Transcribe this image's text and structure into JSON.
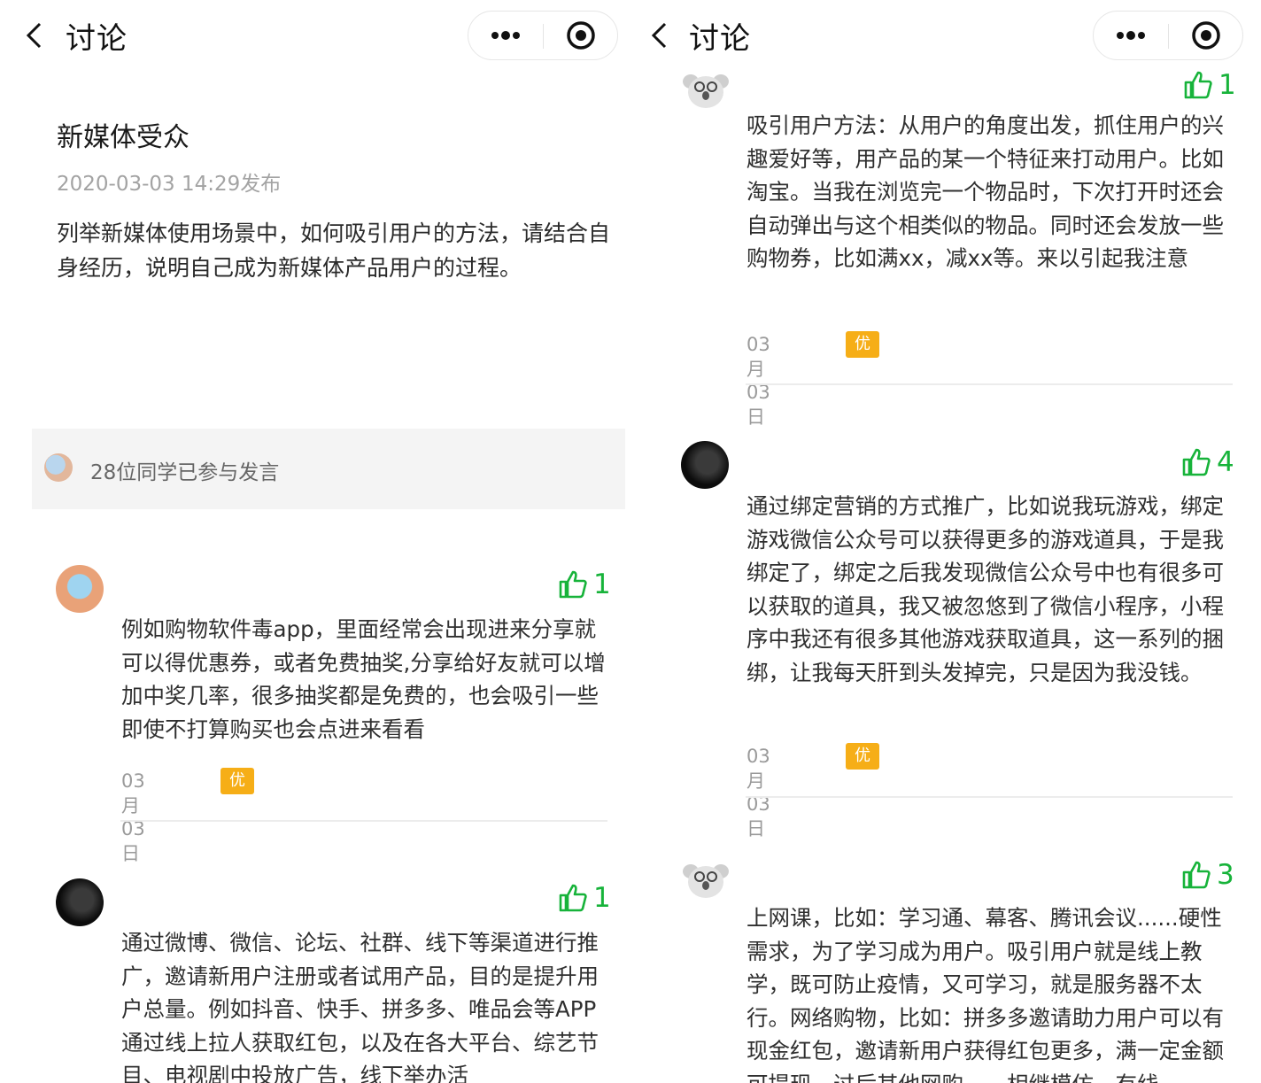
{
  "header": {
    "title": "讨论"
  },
  "topic": {
    "title": "新媒体受众",
    "date": "2020-03-03 14:29发布",
    "body": "列举新媒体使用场景中，如何吸引用户的方法，请结合自身经历，说明自己成为新媒体产品用户的过程。",
    "participants": "28位同学已参与发言"
  },
  "left_comments": [
    {
      "likes": "1",
      "text": "例如购物软件毒app，里面经常会出现进来分享就可以得优惠券，或者免费抽奖,分享给好友就可以增加中奖几率，很多抽奖都是免费的，也会吸引一些即使不打算购买也会点进来看看",
      "date": "03月03日",
      "badge": "优秀发言"
    },
    {
      "likes": "1",
      "text": "通过微博、微信、论坛、社群、线下等渠道进行推广，邀请新用户注册或者试用产品，目的是提升用户总量。例如抖音、快手、拼多多、唯品会等APP通过线上拉人获取红包，以及在各大平台、综艺节目、电视剧中投放广告，线下举办活"
    }
  ],
  "right_comments": [
    {
      "likes": "1",
      "text": "吸引用户方法：从用户的角度出发，抓住用户的兴趣爱好等，用产品的某一个特征来打动用户。比如淘宝。当我在浏览完一个物品时，下次打开时还会自动弹出与这个相类似的物品。同时还会发放一些购物券，比如满xx，减xx等。来以引起我注意",
      "date": "03月03日",
      "badge": "优秀发言"
    },
    {
      "likes": "4",
      "text": "通过绑定营销的方式推广，比如说我玩游戏，绑定游戏微信公众号可以获得更多的游戏道具，于是我绑定了，绑定之后我发现微信公众号中也有很多可以获取的道具，我又被忽悠到了微信小程序，小程序中我还有很多其他游戏获取道具，这一系列的捆绑，让我每天肝到头发掉完，只是因为我没钱。",
      "date": "03月03日",
      "badge": "优秀发言"
    },
    {
      "likes": "3",
      "text": "上网课，比如：学习通、幕客、腾讯会议......硬性需求，为了学习成为用户。吸引用户就是线上教学，既可防止疫情，又可学习，就是服务器不太行。网络购物，比如：拼多多邀请助力用户可以有现金红包，邀请新用户获得红包更多，满一定金额可提现，过后其他网购……相继模仿，有线"
    }
  ],
  "colors": {
    "like_green": "#17b33a",
    "badge_orange": "#f6ae17"
  }
}
